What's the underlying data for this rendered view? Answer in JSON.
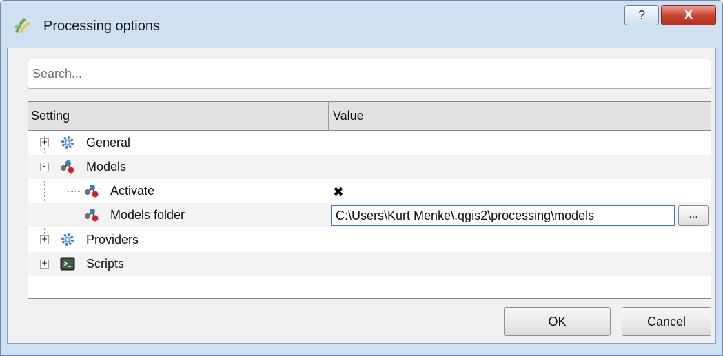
{
  "window": {
    "title": "Processing options",
    "help_label": "?",
    "close_label": "X"
  },
  "search": {
    "placeholder": "Search...",
    "value": ""
  },
  "tree": {
    "columns": {
      "setting": "Setting",
      "value": "Value"
    },
    "rows": [
      {
        "label": "General",
        "icon": "gear-icon",
        "expander": "+"
      },
      {
        "label": "Models",
        "icon": "models-icon",
        "expander": "-"
      },
      {
        "label": "Activate",
        "icon": "models-icon",
        "value": "✖"
      },
      {
        "label": "Models folder",
        "icon": "models-icon",
        "value": "C:\\Users\\Kurt Menke\\.qgis2\\processing\\models",
        "browse_label": "..."
      },
      {
        "label": "Providers",
        "icon": "gear-icon",
        "expander": "+"
      },
      {
        "label": "Scripts",
        "icon": "terminal-icon",
        "expander": "+"
      }
    ]
  },
  "buttons": {
    "ok": "OK",
    "cancel": "Cancel"
  },
  "colors": {
    "title_bar": "#cfe0f2",
    "close_button": "#c9422f",
    "focus_border": "#3a79c9"
  }
}
